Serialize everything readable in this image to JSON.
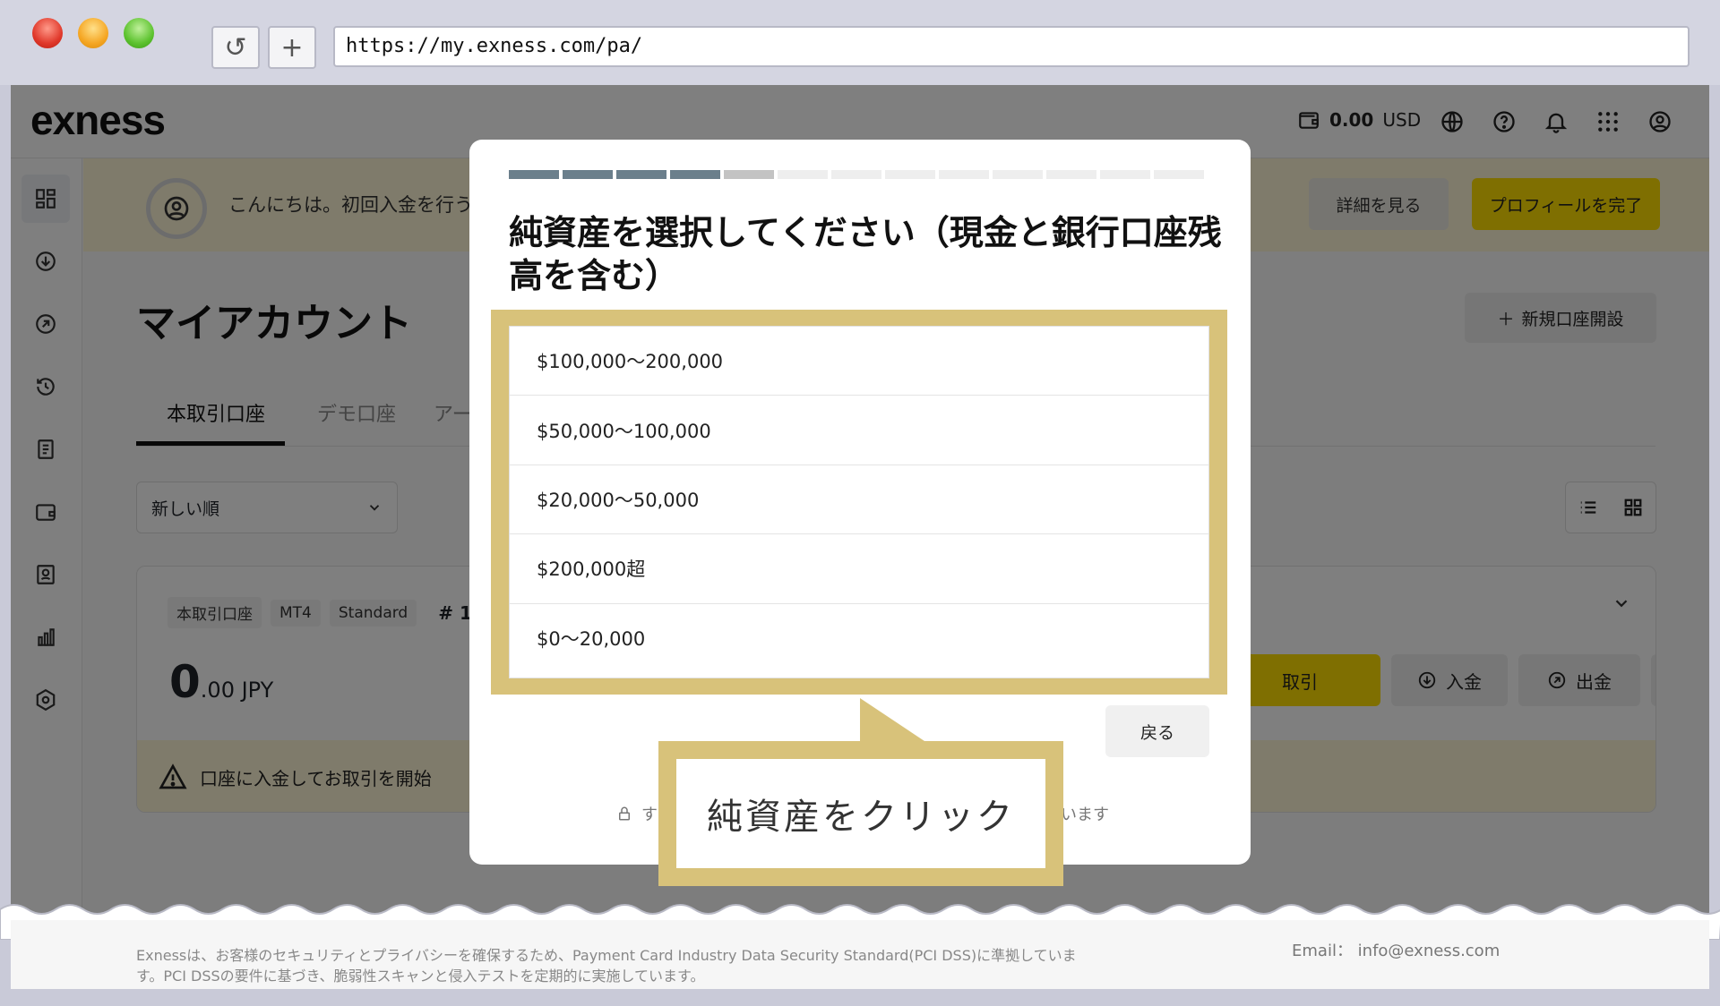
{
  "browser": {
    "url": "https://my.exness.com/pa/",
    "reload_label": "↺",
    "newtab_label": "+"
  },
  "header": {
    "logo": "exness",
    "balance_value": "0.00",
    "balance_currency": "USD",
    "icons": [
      "wallet-icon",
      "globe-icon",
      "help-icon",
      "bell-icon",
      "apps-grid-icon",
      "profile-icon"
    ]
  },
  "sidebar": {
    "icons": [
      "dashboard-icon",
      "deposit-icon",
      "withdraw-icon",
      "history-icon",
      "document-icon",
      "wallet-icon",
      "id-card-icon",
      "analytics-icon",
      "settings-icon"
    ]
  },
  "banner": {
    "text": "こんにちは。初回入金を行うため",
    "detail_button": "詳細を見る",
    "complete_button": "プロフィールを完了"
  },
  "main": {
    "title": "マイアカウント",
    "new_account_button": "新規口座開設",
    "tabs": [
      {
        "label": "本取引口座"
      },
      {
        "label": "デモ口座"
      },
      {
        "label": "アーカ"
      }
    ],
    "sort_label": "新しい順"
  },
  "account_card": {
    "badges": [
      "本取引口座",
      "MT4",
      "Standard"
    ],
    "account_number": "# 1",
    "amount_int": "0",
    "amount_dec": ".00 JPY",
    "trade_button": "取引",
    "deposit_button": "入金",
    "withdraw_button": "出金",
    "warning": "口座に入金してお取引を開始"
  },
  "modal": {
    "progress_total": 13,
    "progress_done": 4,
    "progress_current": 5,
    "title": "純資産を選択してください（現金と銀行口座残高を含む）",
    "options": [
      "$100,000〜200,000",
      "$50,000〜100,000",
      "$20,000〜50,000",
      "$200,000超",
      "$0〜20,000"
    ],
    "back_button": "戻る",
    "secure_text_start": "す",
    "secure_text_end": "います"
  },
  "callout": {
    "text": "純資産をクリック"
  },
  "footer": {
    "text": "Exnessは、お客様のセキュリティとプライバシーを確保するため、Payment Card Industry Data Security Standard(PCI DSS)に準拠しています。PCI DSSの要件に基づき、脆弱性スキャンと侵入テストを定期的に実施しています。",
    "email": "Email： info@exness.com"
  },
  "colors": {
    "accent_yellow": "#ffde02",
    "highlight_gold": "#d8c27a",
    "progress_done": "#6b7f8c"
  }
}
